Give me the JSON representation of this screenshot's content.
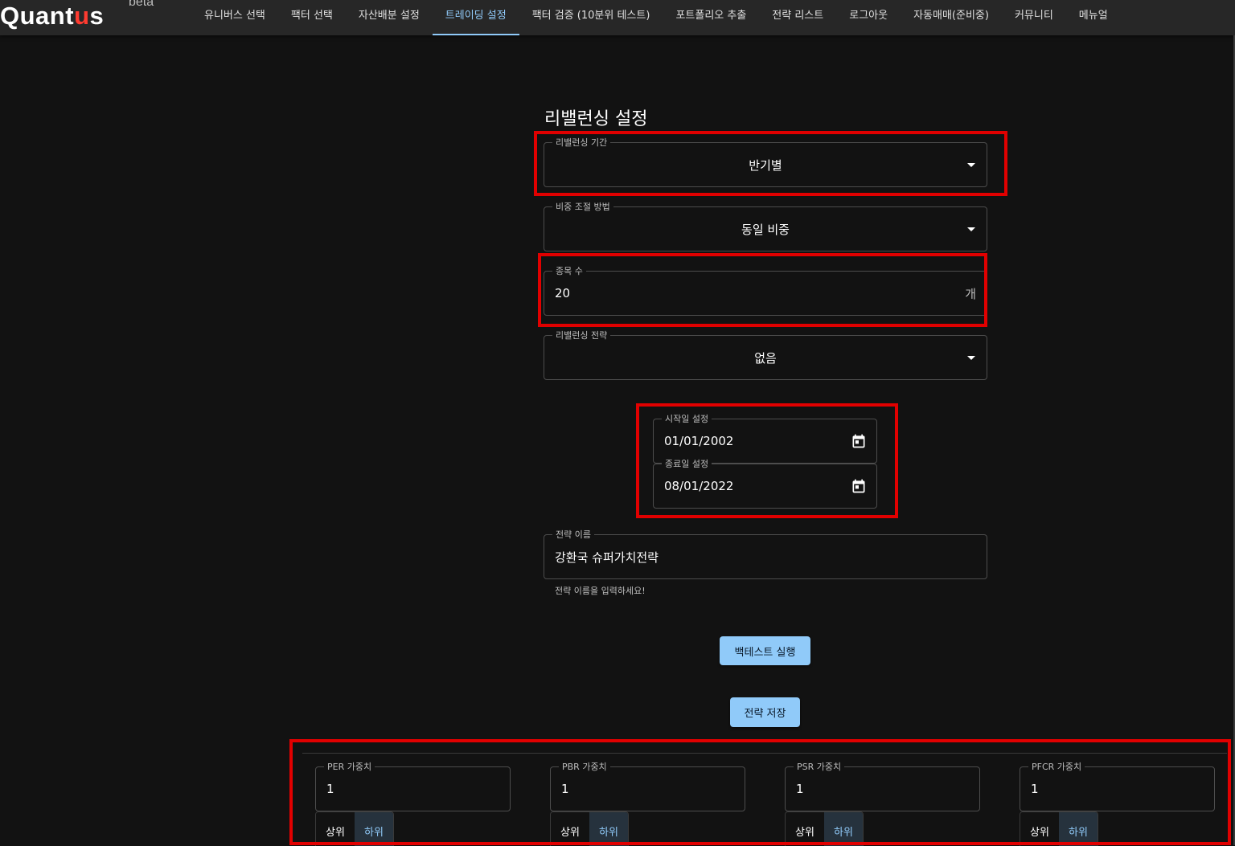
{
  "header": {
    "logo_text": "Quant",
    "logo_mid": "u",
    "logo_end": "s",
    "logo_badge": "beta",
    "nav": [
      {
        "label": "유니버스 선택"
      },
      {
        "label": "팩터 선택"
      },
      {
        "label": "자산배분 설정"
      },
      {
        "label": "트레이딩 설정"
      },
      {
        "label": "팩터 검증 (10분위 테스트)"
      },
      {
        "label": "포트폴리오 추출"
      },
      {
        "label": "전략 리스트"
      },
      {
        "label": "로그아웃"
      },
      {
        "label": "자동매매(준비중)"
      },
      {
        "label": "커뮤니티"
      },
      {
        "label": "메뉴얼"
      }
    ],
    "active_nav_index": 3
  },
  "form": {
    "title": "리밸런싱 설정",
    "rebalance_period": {
      "label": "리밸런싱 기간",
      "value": "반기별"
    },
    "weight_method": {
      "label": "비중 조절 방법",
      "value": "동일 비중"
    },
    "num_stocks": {
      "label": "종목 수",
      "value": "20",
      "suffix": "개"
    },
    "rebalance_strategy": {
      "label": "리밸런싱 전략",
      "value": "없음"
    },
    "start_date": {
      "label": "시작일 설정",
      "value": "01/01/2002"
    },
    "end_date": {
      "label": "종료일 설정",
      "value": "08/01/2022"
    },
    "strategy_name": {
      "label": "전략 이름",
      "value": "강환국 슈퍼가치전략",
      "helper": "전략 이름을 입력하세요!"
    },
    "backtest_button": "백테스트 실행",
    "save_button": "전략 저장"
  },
  "weights": [
    {
      "label": "PER 가중치",
      "value": "1",
      "upper": "상위",
      "lower": "하위",
      "selected": "lower"
    },
    {
      "label": "PBR 가중치",
      "value": "1",
      "upper": "상위",
      "lower": "하위",
      "selected": "lower"
    },
    {
      "label": "PSR 가중치",
      "value": "1",
      "upper": "상위",
      "lower": "하위",
      "selected": "lower"
    },
    {
      "label": "PFCR 가중치",
      "value": "1",
      "upper": "상위",
      "lower": "하위",
      "selected": "lower"
    }
  ],
  "colors": {
    "background": "#121212",
    "appbar": "#272727",
    "accent": "#90caf9",
    "highlight": "#e10000"
  }
}
